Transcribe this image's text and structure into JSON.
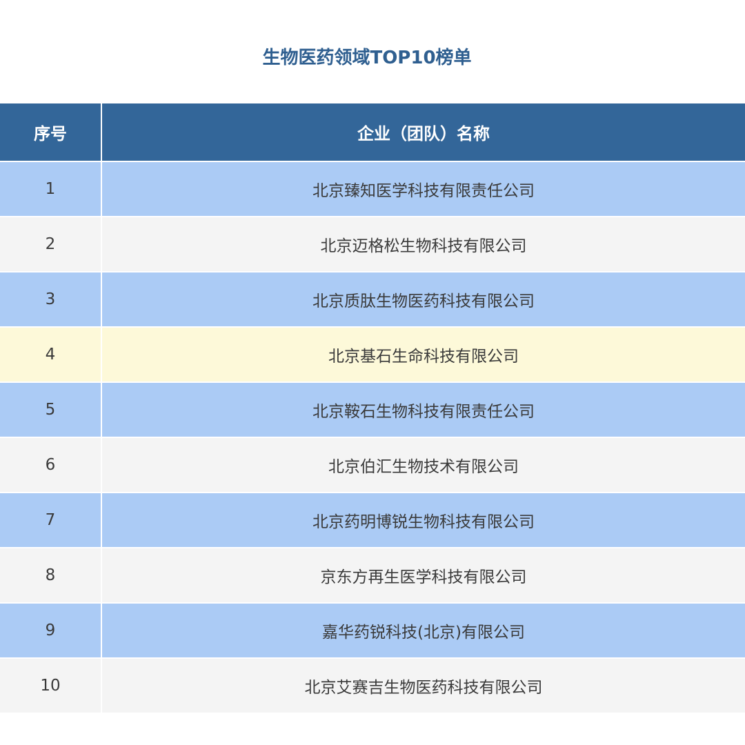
{
  "title": "生物医药领域TOP10榜单",
  "table": {
    "headers": {
      "seq": "序号",
      "name": "企业（团队）名称"
    },
    "rows": [
      {
        "seq": "1",
        "name": "北京臻知医学科技有限责任公司",
        "style": "blue"
      },
      {
        "seq": "2",
        "name": "北京迈格松生物科技有限公司",
        "style": "gray"
      },
      {
        "seq": "3",
        "name": "北京质肽生物医药科技有限公司",
        "style": "blue"
      },
      {
        "seq": "4",
        "name": "北京基石生命科技有限公司",
        "style": "yellow"
      },
      {
        "seq": "5",
        "name": "北京鞍石生物科技有限责任公司",
        "style": "blue"
      },
      {
        "seq": "6",
        "name": "北京伯汇生物技术有限公司",
        "style": "gray"
      },
      {
        "seq": "7",
        "name": "北京药明博锐生物科技有限公司",
        "style": "blue"
      },
      {
        "seq": "8",
        "name": "京东方再生医学科技有限公司",
        "style": "gray"
      },
      {
        "seq": "9",
        "name": "嘉华药锐科技(北京)有限公司",
        "style": "blue"
      },
      {
        "seq": "10",
        "name": "北京艾赛吉生物医药科技有限公司",
        "style": "gray"
      }
    ]
  },
  "colors": {
    "title": "#2f5f90",
    "header_bg": "#336699",
    "row_blue": "#abcbf5",
    "row_gray": "#f4f4f4",
    "row_highlight": "#fdf9d9"
  }
}
